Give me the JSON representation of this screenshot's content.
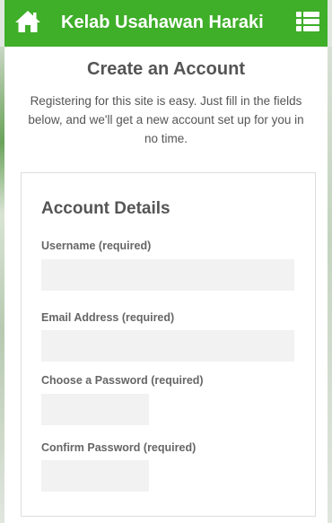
{
  "header": {
    "site_title": "Kelab Usahawan Haraki",
    "home_icon": "home-icon",
    "menu_icon": "list-menu-icon",
    "bar_color": "#3fae29"
  },
  "page": {
    "title": "Create an Account",
    "intro": "Registering for this site is easy. Just fill in the fields below, and we'll get a new account set up for you in no time."
  },
  "form": {
    "section_title": "Account Details",
    "fields": [
      {
        "label": "Username (required)",
        "value": "",
        "placeholder": ""
      },
      {
        "label": "Email Address (required)",
        "value": "",
        "placeholder": ""
      },
      {
        "label": "Choose a Password (required)",
        "value": "",
        "placeholder": ""
      },
      {
        "label": "Confirm Password (required)",
        "value": "",
        "placeholder": ""
      }
    ]
  }
}
